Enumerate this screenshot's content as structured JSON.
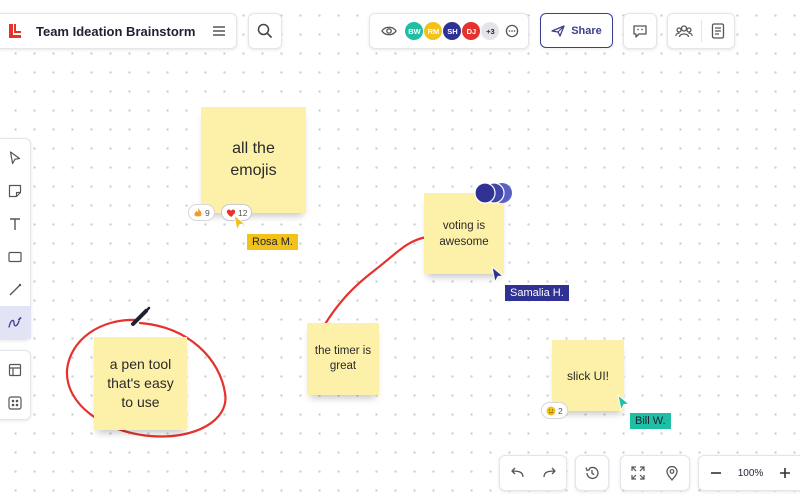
{
  "board": {
    "title": "Team Ideation Brainstorm"
  },
  "colors": {
    "sticky": "#fdf0a8",
    "accent": "#3b3f8c",
    "pen_stroke": "#e5322d",
    "rosa": "#f2c21a",
    "samalia": "#2f3193",
    "bill": "#1fbfa6"
  },
  "collaborators": {
    "avatars": [
      {
        "initials": "BW",
        "color": "#1fbfa6"
      },
      {
        "initials": "RM",
        "color": "#f2c21a"
      },
      {
        "initials": "SH",
        "color": "#2f3193"
      },
      {
        "initials": "DJ",
        "color": "#e5322d"
      }
    ],
    "overflow": "+3"
  },
  "toolbar": {
    "share_label": "Share",
    "zoom_value": "100%",
    "left_tools": [
      "select-icon",
      "sticky-note-icon",
      "text-icon",
      "shape-icon",
      "line-icon",
      "pen-icon"
    ],
    "extra_tools": [
      "template-icon",
      "apps-icon"
    ]
  },
  "stickies": [
    {
      "text": "all the emojis"
    },
    {
      "text": "voting is awesome"
    },
    {
      "text": "the timer is great"
    },
    {
      "text": "a pen tool that's easy to use"
    },
    {
      "text": "slick UI!"
    }
  ],
  "reactions": {
    "fire_count": "9",
    "heart_count": "12",
    "smile_count": "2"
  },
  "cursors": {
    "rosa": "Rosa M.",
    "samalia": "Samalia H.",
    "bill": "Bill W."
  }
}
